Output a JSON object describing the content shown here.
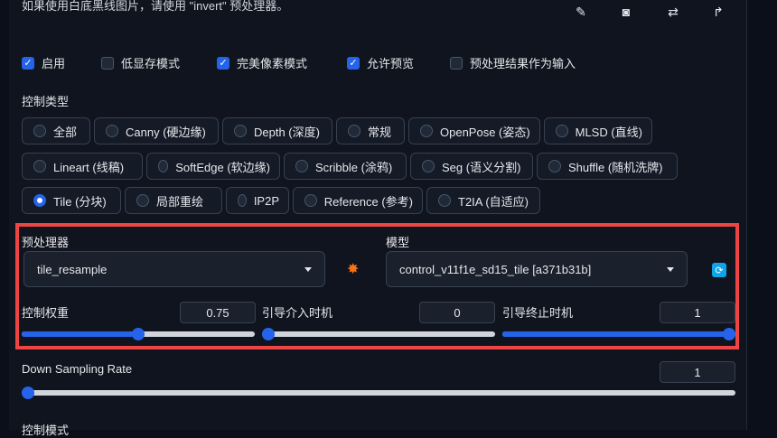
{
  "hint_text": "如果使用白底黑线图片，请使用 \"invert\" 预处理器。",
  "top_icons": [
    "edit-icon",
    "camera-icon",
    "swap-icon",
    "send-icon"
  ],
  "checkboxes": [
    {
      "label": "启用",
      "checked": true
    },
    {
      "label": "低显存模式",
      "checked": false
    },
    {
      "label": "完美像素模式",
      "checked": true
    },
    {
      "label": "允许预览",
      "checked": true
    },
    {
      "label": "预处理结果作为输入",
      "checked": false
    }
  ],
  "control_type": {
    "title": "控制类型",
    "options": [
      [
        "全部",
        "Canny (硬边缘)",
        "Depth (深度)",
        "常规",
        "OpenPose (姿态)",
        "MLSD (直线)"
      ],
      [
        "Lineart (线稿)",
        "SoftEdge (软边缘)",
        "Scribble (涂鸦)",
        "Seg (语义分割)",
        "Shuffle (随机洗牌)"
      ],
      [
        "Tile (分块)",
        "局部重绘",
        "IP2P",
        "Reference (参考)",
        "T2IA (自适应)"
      ]
    ],
    "selected": "Tile (分块)"
  },
  "preprocessor": {
    "label": "预处理器",
    "value": "tile_resample"
  },
  "model": {
    "label": "模型",
    "value": "control_v11f1e_sd15_tile [a371b31b]"
  },
  "sliders": {
    "weight": {
      "label": "控制权重",
      "value": "0.75",
      "fraction": 0.5
    },
    "start": {
      "label": "引导介入时机",
      "value": "0",
      "fraction": 0
    },
    "end": {
      "label": "引导终止时机",
      "value": "1",
      "fraction": 1
    },
    "downsample": {
      "label": "Down Sampling Rate",
      "value": "1",
      "fraction": 0
    }
  },
  "control_mode_title": "控制模式",
  "colors": {
    "accent": "#2563eb",
    "highlight": "#ef4444"
  }
}
